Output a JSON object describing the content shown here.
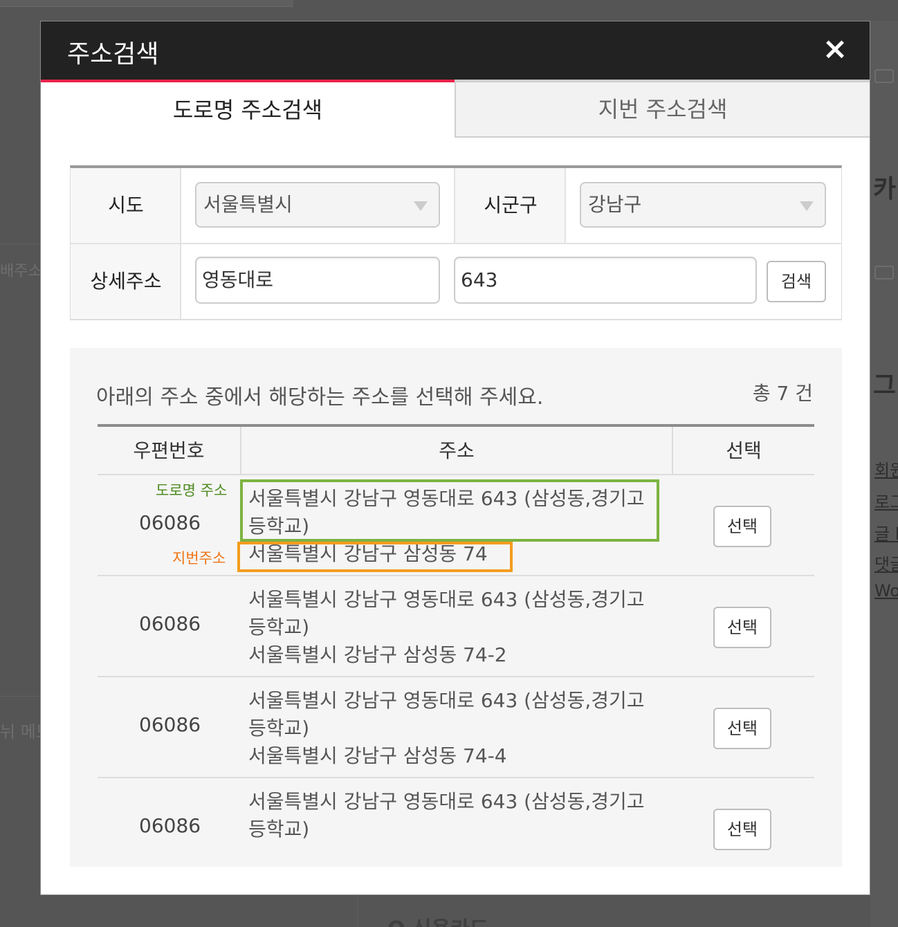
{
  "background": {
    "left_fragments": [
      "배주소",
      "뉘 메모"
    ],
    "right_fragments": [
      "카",
      "그"
    ],
    "right_links": [
      "회원",
      "로그",
      "글 l",
      "댓글",
      "Wo"
    ],
    "bottom_fragment": "Q  신용카드"
  },
  "modal": {
    "title": "주소검색",
    "close_symbol": "×",
    "tabs": [
      {
        "label": "도로명 주소검색",
        "active": true
      },
      {
        "label": "지번 주소검색",
        "active": false
      }
    ],
    "form": {
      "sido_label": "시도",
      "sido_value": "서울특별시",
      "sigungu_label": "시군구",
      "sigungu_value": "강남구",
      "detail_label": "상세주소",
      "detail_road_value": "영동대로",
      "detail_number_value": "643",
      "search_button": "검색"
    },
    "results": {
      "instruction": "아래의 주소 중에서 해당하는 주소를 선택해 주세요.",
      "total": "총 7 건",
      "columns": [
        "우편번호",
        "주소",
        "선택"
      ],
      "road_tag": "도로명 주소",
      "jibun_tag": "지번주소",
      "rows": [
        {
          "zip": "06086",
          "road_line1": "서울특별시 강남구 영동대로 643 (삼성동,경기고",
          "road_line2": "등학교)",
          "jibun": "서울특별시 강남구 삼성동 74",
          "button": "선택"
        },
        {
          "zip": "06086",
          "road_line1": "서울특별시 강남구 영동대로 643 (삼성동,경기고",
          "road_line2": "등학교)",
          "jibun": "서울특별시 강남구 삼성동 74-2",
          "button": "선택"
        },
        {
          "zip": "06086",
          "road_line1": "서울특별시 강남구 영동대로 643 (삼성동,경기고",
          "road_line2": "등학교)",
          "jibun": "서울특별시 강남구 삼성동 74-4",
          "button": "선택"
        },
        {
          "zip": "06086",
          "road_line1": "서울특별시 강남구 영동대로 643 (삼성동,경기고",
          "road_line2": "등학교)",
          "jibun": "",
          "button": "선택"
        }
      ]
    },
    "colors": {
      "header_bg": "#222222",
      "active_tab_accent": "#e8224b",
      "road_highlight": "#7cb342",
      "jibun_highlight": "#f39c1f"
    }
  }
}
